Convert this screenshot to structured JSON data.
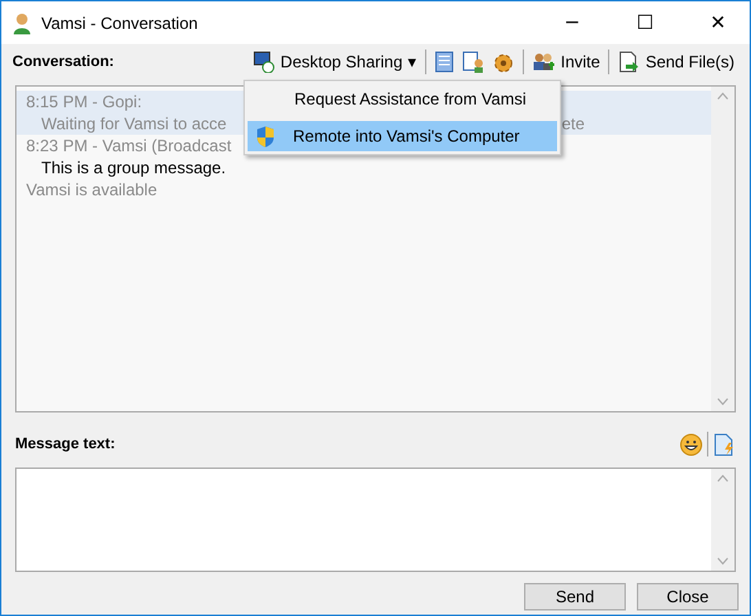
{
  "window": {
    "title": "Vamsi - Conversation",
    "controls": [
      "─",
      "☐",
      "✕"
    ]
  },
  "toolbar": {
    "label": "Conversation:",
    "items": [
      {
        "kind": "menu",
        "label": "Desktop Sharing",
        "caret": "▾"
      },
      {
        "kind": "notes"
      },
      {
        "kind": "info"
      },
      {
        "kind": "gear"
      },
      {
        "kind": "invite",
        "label": "Invite"
      },
      {
        "kind": "sendfile",
        "label": "Send File(s)"
      }
    ]
  },
  "messages": [
    {
      "kind": "header",
      "text": "8:15 PM - Gopi:",
      "highlighted": true
    },
    {
      "kind": "body",
      "text": "Waiting for Vamsi to acce",
      "tail": "ete",
      "muted": true,
      "highlighted": true
    },
    {
      "kind": "header",
      "text": "8:23 PM - Vamsi (Broadcast",
      "highlighted": false
    },
    {
      "kind": "body",
      "text": "This is a group message.",
      "muted": false,
      "highlighted": false
    },
    {
      "kind": "status",
      "text": "Vamsi is available",
      "highlighted": false
    }
  ],
  "menu": {
    "items": [
      {
        "label": "Request Assistance from Vamsi",
        "shield": false,
        "selected": false
      },
      {
        "label": "Remote into Vamsi's Computer",
        "shield": true,
        "selected": true
      }
    ]
  },
  "compose": {
    "label": "Message text:"
  },
  "buttons": [
    "Send",
    "Close"
  ]
}
